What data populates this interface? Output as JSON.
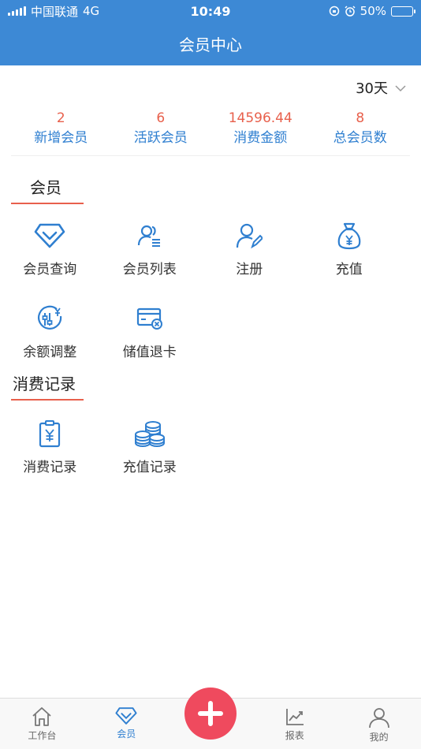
{
  "status_bar": {
    "carrier": "中国联通",
    "network": "4G",
    "time": "10:49",
    "battery": "50%",
    "battery_level": 0.5
  },
  "header": {
    "title": "会员中心"
  },
  "period": {
    "selected": "30天"
  },
  "stats": [
    {
      "value": "2",
      "label": "新增会员"
    },
    {
      "value": "6",
      "label": "活跃会员"
    },
    {
      "value": "14596.44",
      "label": "消费金额"
    },
    {
      "value": "8",
      "label": "总会员数"
    }
  ],
  "sections": {
    "member": {
      "title": "会员",
      "items": [
        {
          "label": "会员查询",
          "icon": "diamond-icon"
        },
        {
          "label": "会员列表",
          "icon": "member-list-icon"
        },
        {
          "label": "注册",
          "icon": "register-user-icon"
        },
        {
          "label": "充值",
          "icon": "money-bag-icon"
        },
        {
          "label": "余额调整",
          "icon": "balance-adjust-icon"
        },
        {
          "label": "储值退卡",
          "icon": "card-refund-icon"
        }
      ]
    },
    "records": {
      "title": "消费记录",
      "items": [
        {
          "label": "消费记录",
          "icon": "receipt-icon"
        },
        {
          "label": "充值记录",
          "icon": "coins-icon"
        }
      ]
    }
  },
  "tabbar": {
    "items": [
      {
        "label": "工作台",
        "icon": "home-icon"
      },
      {
        "label": "会员",
        "icon": "diamond-icon"
      },
      {
        "label": "报表",
        "icon": "chart-icon"
      },
      {
        "label": "我的",
        "icon": "user-icon"
      }
    ],
    "active_index": 1,
    "fab_icon": "plus-icon"
  },
  "colors": {
    "primary": "#3d89d5",
    "accent": "#e8604c",
    "fab": "#ef4a5e",
    "label_blue": "#2f7fd0"
  }
}
